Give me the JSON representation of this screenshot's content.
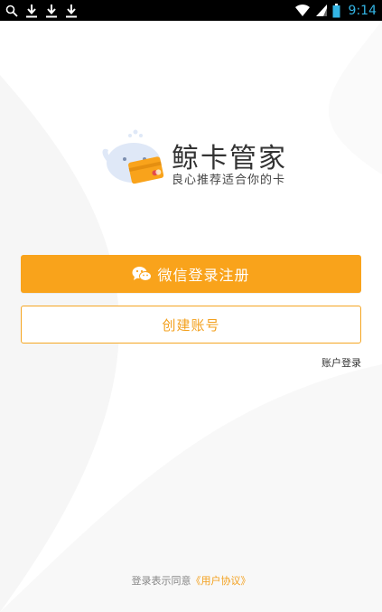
{
  "status_bar": {
    "time": "9:14",
    "left_icons": [
      "search-icon",
      "download-icon",
      "download-icon",
      "download-icon"
    ],
    "right_icons": [
      "wifi-icon",
      "signal-icon",
      "battery-icon"
    ]
  },
  "brand": {
    "name": "鲸卡管家",
    "slogan": "良心推荐适合你的卡"
  },
  "buttons": {
    "wechat_login": "微信登录注册",
    "create_account": "创建账号"
  },
  "links": {
    "account_login": "账户登录"
  },
  "agreement": {
    "prefix": "登录表示同意",
    "link": "《用户协议》"
  },
  "colors": {
    "accent": "#f9a31b",
    "status_time": "#33b5e5",
    "background": "#ffffff"
  }
}
